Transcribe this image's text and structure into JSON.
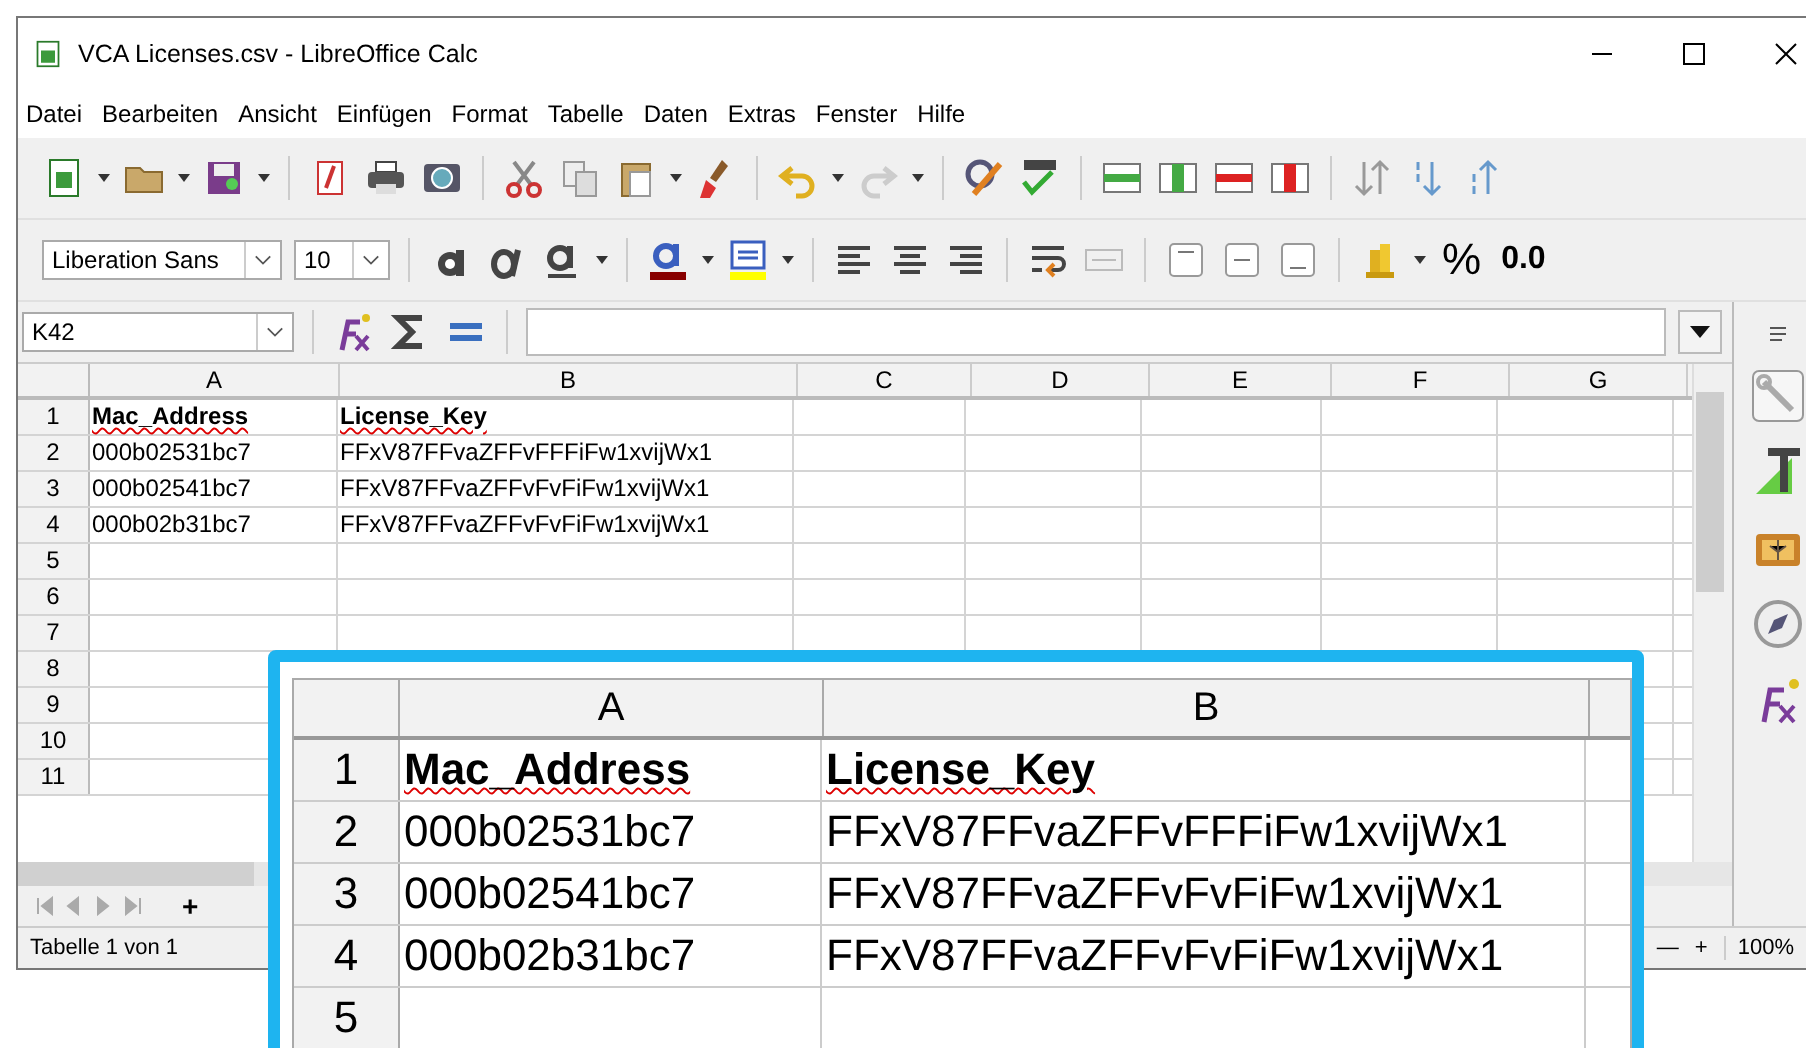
{
  "window": {
    "title": "VCA Licenses.csv - LibreOffice Calc"
  },
  "menu": [
    "Datei",
    "Bearbeiten",
    "Ansicht",
    "Einfügen",
    "Format",
    "Tabelle",
    "Daten",
    "Extras",
    "Fenster",
    "Hilfe"
  ],
  "formatting": {
    "font_name": "Liberation Sans",
    "font_size": "10",
    "percent": "%",
    "decimal": "0.0"
  },
  "name_box": "K42",
  "sheet": {
    "columns": [
      "A",
      "B",
      "C",
      "D",
      "E",
      "F",
      "G"
    ],
    "rows": [
      {
        "number": "1",
        "cells": [
          {
            "text": "Mac_Address",
            "bold": true,
            "misspelled": true
          },
          {
            "text": "License_Key",
            "bold": true,
            "misspelled": true
          }
        ]
      },
      {
        "number": "2",
        "cells": [
          {
            "text": "000b02531bc7",
            "bold": false,
            "misspelled": false
          },
          {
            "text": "FFxV87FFvaZFFvFFFiFw1xvijWx1",
            "bold": false,
            "misspelled": false
          }
        ]
      },
      {
        "number": "3",
        "cells": [
          {
            "text": "000b02541bc7",
            "bold": false,
            "misspelled": false
          },
          {
            "text": "FFxV87FFvaZFFvFvFiFw1xvijWx1",
            "bold": false,
            "misspelled": false
          }
        ]
      },
      {
        "number": "4",
        "cells": [
          {
            "text": "000b02b31bc7",
            "bold": false,
            "misspelled": false
          },
          {
            "text": "FFxV87FFvaZFFvFvFiFw1xvijWx1",
            "bold": false,
            "misspelled": false
          }
        ]
      },
      {
        "number": "5",
        "cells": []
      },
      {
        "number": "6",
        "cells": []
      },
      {
        "number": "7",
        "cells": []
      },
      {
        "number": "8",
        "cells": []
      },
      {
        "number": "9",
        "cells": []
      },
      {
        "number": "10",
        "cells": []
      },
      {
        "number": "11",
        "cells": []
      }
    ]
  },
  "sheet_tabs": {
    "add": "+"
  },
  "status_bar": {
    "sheet": "Tabelle 1 von 1",
    "zoom_minus": "—",
    "zoom_plus": "+",
    "zoom": "100%"
  },
  "magnifier": {
    "columns": [
      "A",
      "B"
    ],
    "rows": [
      {
        "number": "1",
        "cells": [
          {
            "text": "Mac_Address",
            "bold": true,
            "misspelled": true
          },
          {
            "text": "License_Key",
            "bold": true,
            "misspelled": true
          }
        ]
      },
      {
        "number": "2",
        "cells": [
          {
            "text": "000b02531bc7",
            "bold": false,
            "misspelled": false
          },
          {
            "text": "FFxV87FFvaZFFvFFFiFw1xvijWx1",
            "bold": false,
            "misspelled": false
          }
        ]
      },
      {
        "number": "3",
        "cells": [
          {
            "text": "000b02541bc7",
            "bold": false,
            "misspelled": false
          },
          {
            "text": "FFxV87FFvaZFFvFvFiFw1xvijWx1",
            "bold": false,
            "misspelled": false
          }
        ]
      },
      {
        "number": "4",
        "cells": [
          {
            "text": "000b02b31bc7",
            "bold": false,
            "misspelled": false
          },
          {
            "text": "FFxV87FFvaZFFvFvFiFw1xvijWx1",
            "bold": false,
            "misspelled": false
          }
        ]
      },
      {
        "number": "5",
        "cells": []
      }
    ]
  }
}
